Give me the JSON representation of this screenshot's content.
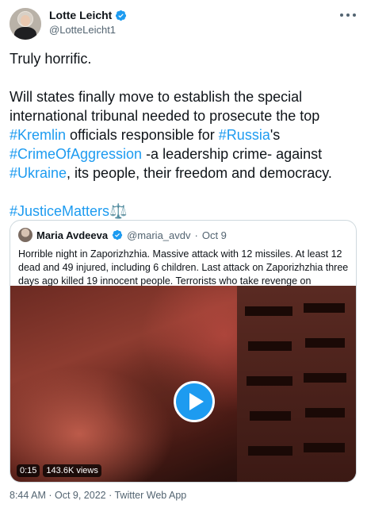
{
  "author": {
    "name": "Lotte Leicht",
    "handle": "@LotteLeicht1"
  },
  "tweet": {
    "line1": "Truly horrific.",
    "p2": {
      "t1": "Will states finally move to establish the special international tribunal needed to prosecute the top ",
      "h1": "#Kremlin",
      "t2": " officials responsible for ",
      "h2": "#Russia",
      "t3": "'s ",
      "h3": "#CrimeOfAggression",
      "t4": " -a leadership crime- against ",
      "h4": "#Ukraine",
      "t5": ", its people, their freedom and democracy."
    },
    "hashtag_line": "#JusticeMatters",
    "hashtag_line_emoji": "⚖️"
  },
  "quote": {
    "name": "Maria Avdeeva",
    "handle": "@maria_avdv",
    "separator": "·",
    "date": "Oct 9",
    "text": "Horrible night in Zaporizhzhia. Massive attack with 12 missiles. At least 12 dead and 49 injured, including 6 children. Last attack on Zaporizhzhia three days ago killed 19 innocent people. Terrorists who take revenge on civilians.",
    "video": {
      "duration": "0:15",
      "views": "143.6K views"
    }
  },
  "footer": {
    "text": "8:44 AM · Oct 9, 2022 · Twitter Web App"
  },
  "colors": {
    "accent": "#1d9bf0",
    "text": "#0f1419",
    "secondary": "#536471",
    "border": "#cfd9de"
  },
  "icons": {
    "verified": "verified-badge-icon",
    "more": "more-options-icon",
    "play": "play-icon"
  }
}
